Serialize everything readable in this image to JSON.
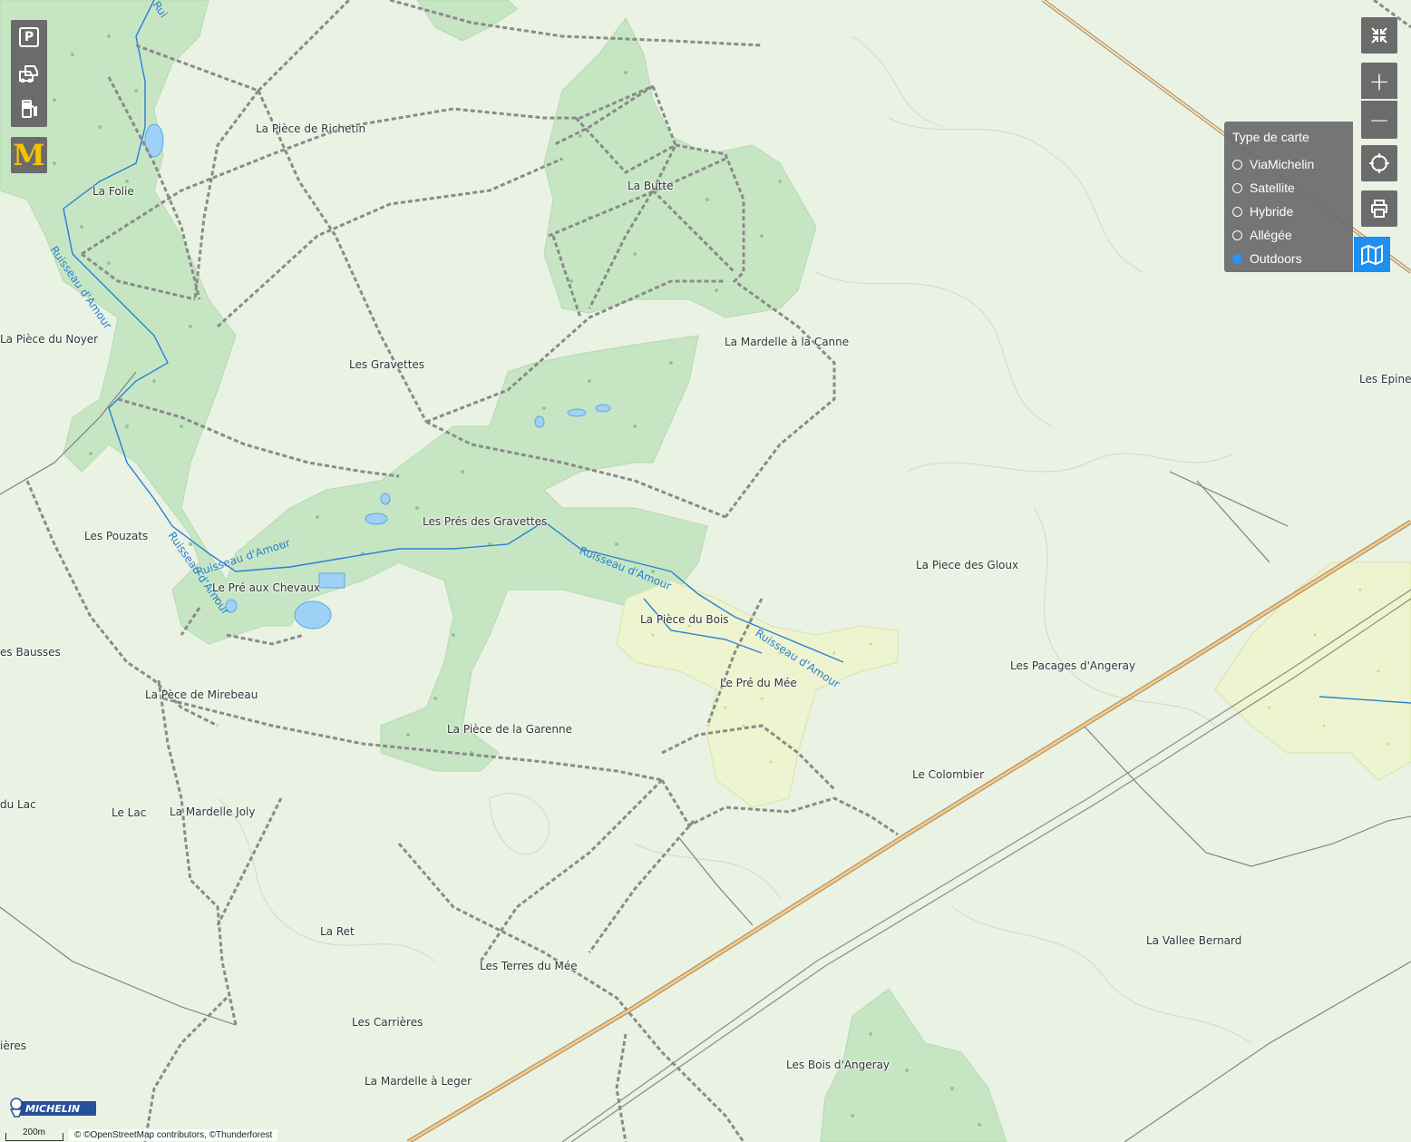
{
  "places": [
    {
      "text": "La Pièce de Richetin"
    },
    {
      "text": "La Folie"
    },
    {
      "text": "La Butte"
    },
    {
      "text": "La Pièce du Noyer"
    },
    {
      "text": "La Mardelle à la Canne"
    },
    {
      "text": "Les Gravettes"
    },
    {
      "text": "Les Epinet"
    },
    {
      "text": "Les Prés des Gravettes"
    },
    {
      "text": "Les Pouzats"
    },
    {
      "text": "La Piece des Gloux"
    },
    {
      "text": "Le Pré aux Chevaux"
    },
    {
      "text": "La Pièce du Bois"
    },
    {
      "text": "es Bausses"
    },
    {
      "text": "Le Pré du Mée"
    },
    {
      "text": "Les Pacages d'Angeray"
    },
    {
      "text": "La Pèce de Mirebeau"
    },
    {
      "text": "La Pièce de la Garenne"
    },
    {
      "text": "Le Colombier"
    },
    {
      "text": "du Lac"
    },
    {
      "text": "Le Lac"
    },
    {
      "text": "La Mardelle Joly"
    },
    {
      "text": "La Ret"
    },
    {
      "text": "La Vallee Bernard"
    },
    {
      "text": "Les Terres du Mée"
    },
    {
      "text": "Les Carrières"
    },
    {
      "text": "ières"
    },
    {
      "text": "Les Bois d'Angeray"
    },
    {
      "text": "La Mardelle à Leger"
    }
  ],
  "water_labels": [
    "Ruisseau d'Amour",
    "Ruisseau d'Amour",
    "Ruisseau d'Amour",
    "Ruisseau d'Amour",
    "Ruisseau d'Amour",
    "Rui"
  ],
  "left_toolbar": [
    {
      "name": "parking-button",
      "icon": "parking-icon",
      "glyph": "P"
    },
    {
      "name": "traffic-button",
      "icon": "cars-icon",
      "glyph": ""
    },
    {
      "name": "fuel-button",
      "icon": "fuel-pump-icon",
      "glyph": ""
    },
    {
      "name": "mcdonalds-button",
      "icon": "mcdonalds-icon",
      "glyph": "M"
    }
  ],
  "right_toolbar": {
    "fullscreen_icon": "collapse-icon",
    "zoom_in": "+",
    "zoom_out": "−",
    "locate_icon": "crosshair-icon",
    "print_icon": "printer-icon",
    "maptype_icon": "map-icon"
  },
  "map_type": {
    "title": "Type de carte",
    "options": [
      {
        "label": "ViaMichelin",
        "selected": false
      },
      {
        "label": "Satellite",
        "selected": false
      },
      {
        "label": "Hybride",
        "selected": false
      },
      {
        "label": "Allégée",
        "selected": false
      },
      {
        "label": "Outdoors",
        "selected": true
      }
    ]
  },
  "logo": "MICHELIN",
  "scale": "200m",
  "attribution": "© ©OpenStreetMap contributors, ©Thunderforest",
  "colors": {
    "background": "#e9f2e3",
    "forest": "#c6e6c3",
    "scrub": "#eff5cf",
    "water": "#2a7fd4",
    "highway": "#f3c88d",
    "accent": "#1d8ff0"
  }
}
